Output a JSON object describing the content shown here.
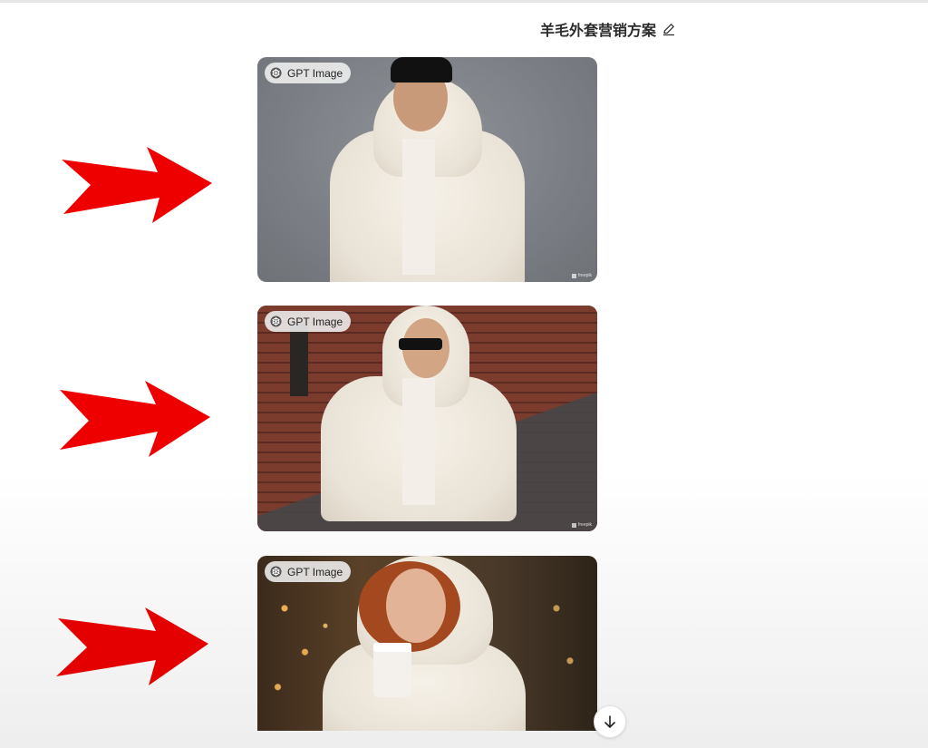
{
  "header": {
    "title": "羊毛外套营销方案"
  },
  "images": [
    {
      "badge_label": "GPT Image",
      "watermark": "freepik"
    },
    {
      "badge_label": "GPT Image",
      "watermark": "freepik"
    },
    {
      "badge_label": "GPT Image"
    }
  ],
  "icons": {
    "edit": "pencil-icon",
    "badge": "openai-logo-icon",
    "arrow": "red-arrow-icon",
    "scroll": "arrow-down-icon"
  },
  "colors": {
    "arrow": "#ee0000",
    "title": "#2b2b2b"
  }
}
